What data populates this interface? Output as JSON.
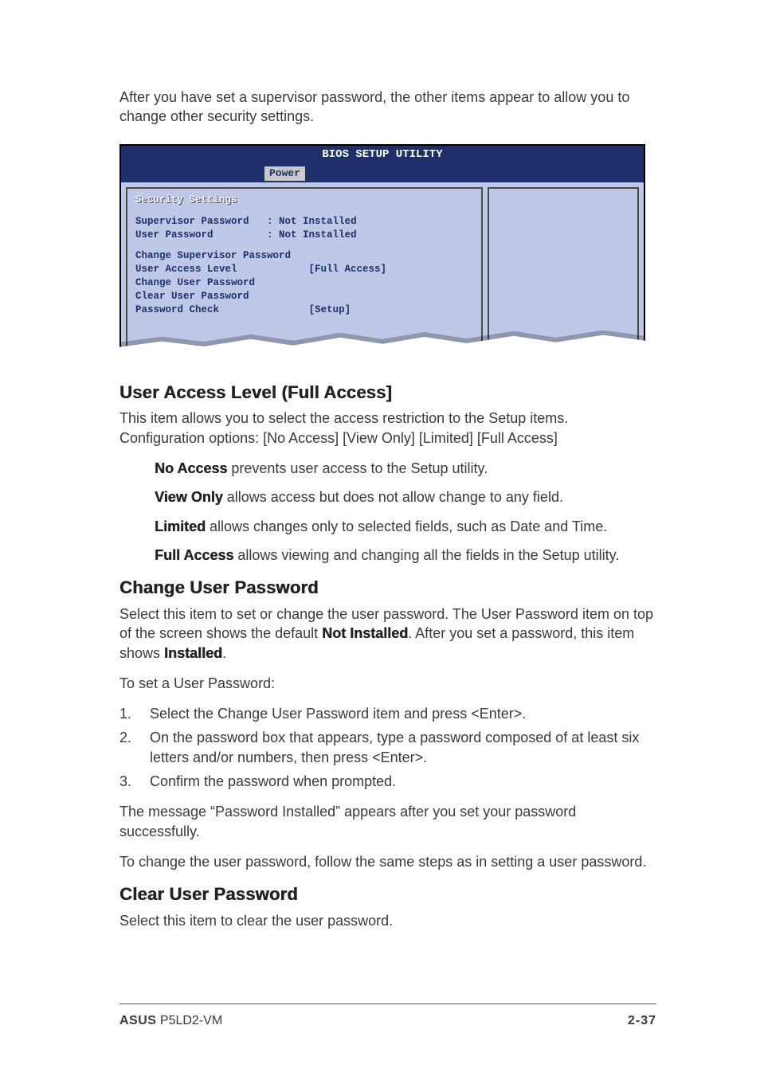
{
  "intro": "After you have set a supervisor password, the other items appear to allow you to change other security settings.",
  "bios": {
    "title": "BIOS SETUP UTILITY",
    "tab": "Power",
    "section_title": "Security Settings",
    "rows": {
      "supervisor_label": "Supervisor Password",
      "supervisor_value": ": Not Installed",
      "user_label": "User Password",
      "user_value": ": Not Installed"
    },
    "items": {
      "change_supervisor": "Change Supervisor Password",
      "user_access_label": "User Access Level",
      "user_access_value": "[Full Access]",
      "change_user": "Change User Password",
      "clear_user": "Clear User Password",
      "pw_check_label": "Password Check",
      "pw_check_value": "[Setup]"
    }
  },
  "sections": {
    "ual": {
      "heading": "User Access Level (Full Access]",
      "desc": "This item allows you to select the access restriction to the Setup items. Configuration options: [No Access] [View Only] [Limited] [Full Access]",
      "no_access_b": "No Access",
      "no_access_t": " prevents user access to the Setup utility.",
      "view_only_b": "View Only",
      "view_only_t": " allows access but does not allow change to any field.",
      "limited_b": "Limited",
      "limited_t": " allows changes only to selected fields, such as Date and Time.",
      "full_access_b": "Full Access",
      "full_access_t": " allows viewing and changing all the fields in the Setup utility."
    },
    "cup": {
      "heading": "Change User Password",
      "p1a": "Select this item to set or change the user password. The User Password item on top of the screen shows the default ",
      "p1b": "Not Installed",
      "p1c": ". After you set a password, this item shows ",
      "p1d": "Installed",
      "p1e": ".",
      "p2": "To set a User Password:",
      "steps": [
        "Select the Change User Password item and press <Enter>.",
        "On the password box that appears, type a password composed of at least six letters and/or numbers, then press <Enter>.",
        "Confirm the password when prompted."
      ],
      "p3": "The message “Password Installed” appears after you set your password successfully.",
      "p4": "To change the user password, follow the same steps as in setting a user password."
    },
    "clp": {
      "heading": "Clear User Password",
      "desc": "Select this item to clear the user password."
    }
  },
  "footer": {
    "brand": "ASUS",
    "model": " P5LD2-VM",
    "page": "2-37"
  }
}
